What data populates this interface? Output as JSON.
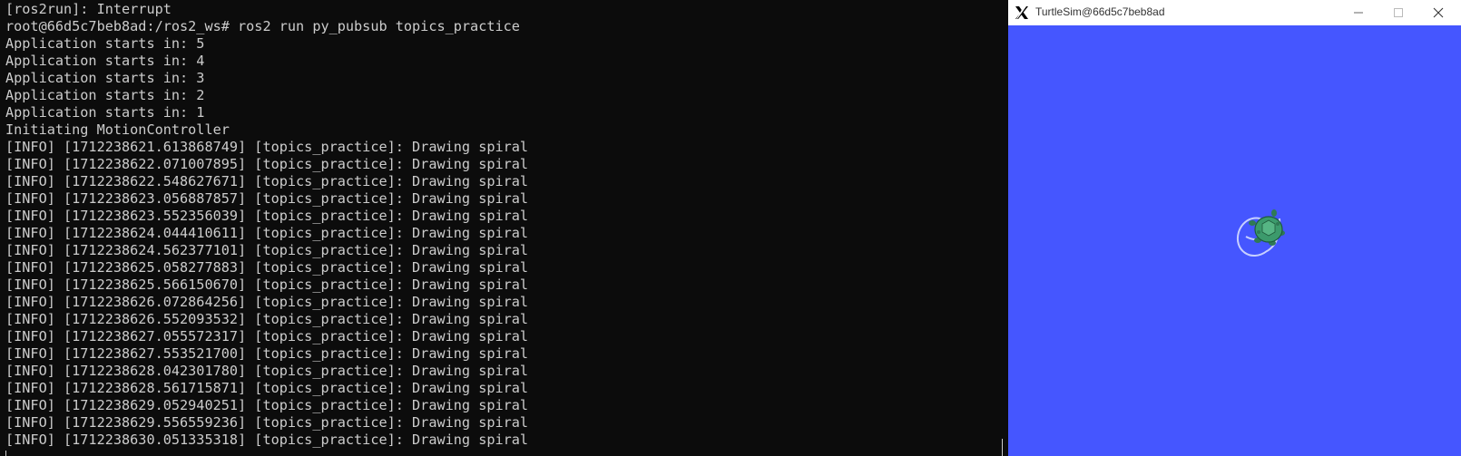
{
  "colors": {
    "terminal_bg": "#0c0c0c",
    "terminal_fg": "#cccccc",
    "turtlesim_bg": "#4556ff",
    "trail": "#c8d0ff",
    "turtle_shell": "#3c9a6c"
  },
  "terminal": {
    "lines": [
      "[ros2run]: Interrupt",
      "root@66d5c7beb8ad:/ros2_ws# ros2 run py_pubsub topics_practice",
      "Application starts in: 5",
      "Application starts in: 4",
      "Application starts in: 3",
      "Application starts in: 2",
      "Application starts in: 1",
      "Initiating MotionController",
      "[INFO] [1712238621.613868749] [topics_practice]: Drawing spiral",
      "[INFO] [1712238622.071007895] [topics_practice]: Drawing spiral",
      "[INFO] [1712238622.548627671] [topics_practice]: Drawing spiral",
      "[INFO] [1712238623.056887857] [topics_practice]: Drawing spiral",
      "[INFO] [1712238623.552356039] [topics_practice]: Drawing spiral",
      "[INFO] [1712238624.044410611] [topics_practice]: Drawing spiral",
      "[INFO] [1712238624.562377101] [topics_practice]: Drawing spiral",
      "[INFO] [1712238625.058277883] [topics_practice]: Drawing spiral",
      "[INFO] [1712238625.566150670] [topics_practice]: Drawing spiral",
      "[INFO] [1712238626.072864256] [topics_practice]: Drawing spiral",
      "[INFO] [1712238626.552093532] [topics_practice]: Drawing spiral",
      "[INFO] [1712238627.055572317] [topics_practice]: Drawing spiral",
      "[INFO] [1712238627.553521700] [topics_practice]: Drawing spiral",
      "[INFO] [1712238628.042301780] [topics_practice]: Drawing spiral",
      "[INFO] [1712238628.561715871] [topics_practice]: Drawing spiral",
      "[INFO] [1712238629.052940251] [topics_practice]: Drawing spiral",
      "[INFO] [1712238629.556559236] [topics_practice]: Drawing spiral",
      "[INFO] [1712238630.051335318] [topics_practice]: Drawing spiral"
    ]
  },
  "turtlesim": {
    "title": "TurtleSim@66d5c7beb8ad",
    "icons": {
      "app": "x11-logo-icon",
      "minimize": "minimize-icon",
      "maximize": "maximize-icon",
      "close": "close-icon"
    }
  }
}
